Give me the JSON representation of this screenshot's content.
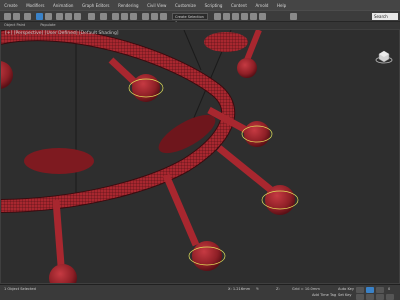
{
  "menu": [
    "Create",
    "Modifiers",
    "Animation",
    "Graph Editors",
    "Rendering",
    "Civil View",
    "Customize",
    "Scripting",
    "Content",
    "Arnold",
    "Help"
  ],
  "toolbar": {
    "selection_set_placeholder": "Create Selection Se",
    "search_placeholder": "Search"
  },
  "ribbon": {
    "items": [
      "Object Paint",
      "Populate"
    ]
  },
  "viewport": {
    "label": "[+] [Perspective] [User Defined] [Default Shading]"
  },
  "status": {
    "selected": "1 Object Selected",
    "x": "X: 1.216mm",
    "y": "Y:",
    "z": "Z:",
    "grid": "Grid = 10.0mm",
    "add_time_tag": "Add Time Tag",
    "auto_key": "Auto Key",
    "set_key": "Set Key",
    "frame": "0"
  },
  "colors": {
    "mesh": "#a8272f",
    "wire": "#3a0a0e",
    "gizmo": "#e0e05a",
    "viewport_bg": "#2e2e2e"
  }
}
